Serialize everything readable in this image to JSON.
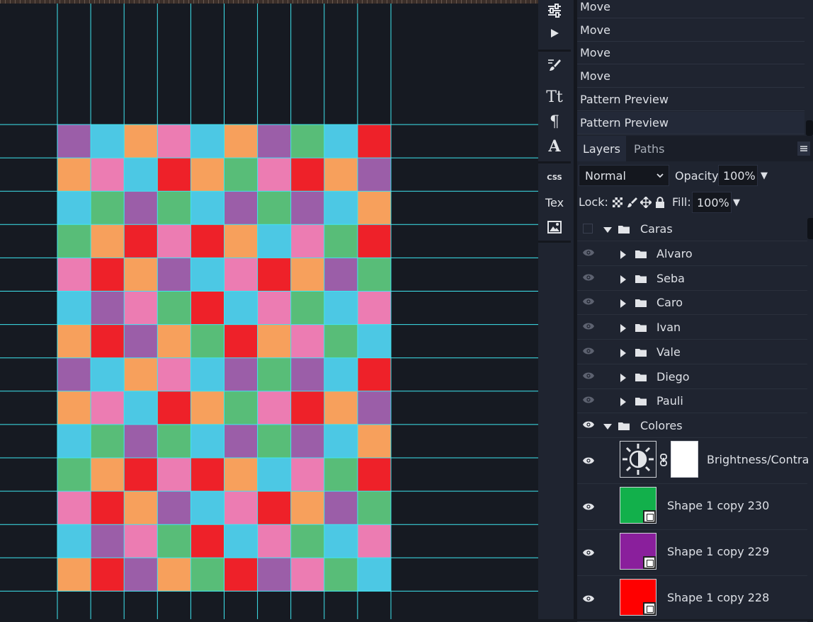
{
  "canvas": {
    "cols": 10,
    "rows": 14,
    "grid_colors": [
      [
        "#9b5ea8",
        "#4cc8e4",
        "#f7a05c",
        "#ec7cb2",
        "#4cc8e4",
        "#f7a05c",
        "#9b5ea8",
        "#58bd78",
        "#4cc8e4",
        "#ee2129"
      ],
      [
        "#f7a05c",
        "#ec7cb2",
        "#4cc8e4",
        "#ee2129",
        "#f7a05c",
        "#58bd78",
        "#ec7cb2",
        "#ee2129",
        "#f7a05c",
        "#9b5ea8"
      ],
      [
        "#4cc8e4",
        "#58bd78",
        "#9b5ea8",
        "#58bd78",
        "#4cc8e4",
        "#9b5ea8",
        "#58bd78",
        "#9b5ea8",
        "#4cc8e4",
        "#f7a05c"
      ],
      [
        "#58bd78",
        "#f7a05c",
        "#ee2129",
        "#ec7cb2",
        "#ee2129",
        "#f7a05c",
        "#4cc8e4",
        "#ec7cb2",
        "#58bd78",
        "#ee2129"
      ],
      [
        "#ec7cb2",
        "#ee2129",
        "#f7a05c",
        "#9b5ea8",
        "#4cc8e4",
        "#ec7cb2",
        "#ee2129",
        "#f7a05c",
        "#9b5ea8",
        "#58bd78"
      ],
      [
        "#4cc8e4",
        "#9b5ea8",
        "#ec7cb2",
        "#58bd78",
        "#ee2129",
        "#4cc8e4",
        "#ec7cb2",
        "#58bd78",
        "#4cc8e4",
        "#ec7cb2"
      ],
      [
        "#f7a05c",
        "#ee2129",
        "#9b5ea8",
        "#f7a05c",
        "#58bd78",
        "#ee2129",
        "#f7a05c",
        "#ec7cb2",
        "#58bd78",
        "#4cc8e4"
      ],
      [
        "#9b5ea8",
        "#4cc8e4",
        "#f7a05c",
        "#ec7cb2",
        "#4cc8e4",
        "#9b5ea8",
        "#58bd78",
        "#9b5ea8",
        "#4cc8e4",
        "#ee2129"
      ],
      [
        "#f7a05c",
        "#ec7cb2",
        "#4cc8e4",
        "#ee2129",
        "#f7a05c",
        "#58bd78",
        "#ec7cb2",
        "#ee2129",
        "#f7a05c",
        "#9b5ea8"
      ],
      [
        "#4cc8e4",
        "#58bd78",
        "#9b5ea8",
        "#58bd78",
        "#4cc8e4",
        "#9b5ea8",
        "#58bd78",
        "#9b5ea8",
        "#4cc8e4",
        "#f7a05c"
      ],
      [
        "#58bd78",
        "#f7a05c",
        "#ee2129",
        "#ec7cb2",
        "#ee2129",
        "#f7a05c",
        "#4cc8e4",
        "#ec7cb2",
        "#58bd78",
        "#ee2129"
      ],
      [
        "#ec7cb2",
        "#ee2129",
        "#f7a05c",
        "#9b5ea8",
        "#4cc8e4",
        "#ec7cb2",
        "#ee2129",
        "#f7a05c",
        "#9b5ea8",
        "#58bd78"
      ],
      [
        "#4cc8e4",
        "#9b5ea8",
        "#ec7cb2",
        "#58bd78",
        "#ee2129",
        "#4cc8e4",
        "#ec7cb2",
        "#58bd78",
        "#4cc8e4",
        "#ec7cb2"
      ],
      [
        "#f7a05c",
        "#ee2129",
        "#9b5ea8",
        "#f7a05c",
        "#58bd78",
        "#ee2129",
        "#9b5ea8",
        "#ec7cb2",
        "#58bd78",
        "#4cc8e4"
      ]
    ],
    "guide_color": "#3ee6f0",
    "background": "#161a22"
  },
  "toolbar": {
    "tools": [
      {
        "name": "adjustments-icon"
      },
      {
        "name": "play-icon"
      },
      {
        "name": "brush-preset-icon"
      },
      {
        "name": "character-icon"
      },
      {
        "name": "paragraph-icon"
      },
      {
        "name": "glyphs-icon"
      },
      {
        "name": "css-icon",
        "label": "CSS"
      },
      {
        "name": "text-tool",
        "label": "Tex"
      },
      {
        "name": "image-icon"
      }
    ]
  },
  "history": {
    "items": [
      "Move",
      "Move",
      "Move",
      "Move",
      "Pattern Preview",
      "Pattern Preview"
    ]
  },
  "tabs": {
    "layers": "Layers",
    "paths": "Paths"
  },
  "blend": {
    "mode": "Normal",
    "opacity_label": "Opacity:",
    "opacity_value": "100%"
  },
  "lock": {
    "label": "Lock:",
    "fill_label": "Fill:",
    "fill_value": "100%"
  },
  "layers": {
    "group_caras": "Caras",
    "caras_children": [
      "Alvaro",
      "Seba",
      "Caro",
      "Ivan",
      "Vale",
      "Diego",
      "Pauli"
    ],
    "group_colores": "Colores",
    "adjustment": "Brightness/Contra",
    "shapes": [
      {
        "name": "Shape 1 copy 230",
        "color": "#12b04b"
      },
      {
        "name": "Shape 1 copy 229",
        "color": "#8a1f9c"
      },
      {
        "name": "Shape 1 copy 228",
        "color": "#ff0000"
      }
    ]
  }
}
